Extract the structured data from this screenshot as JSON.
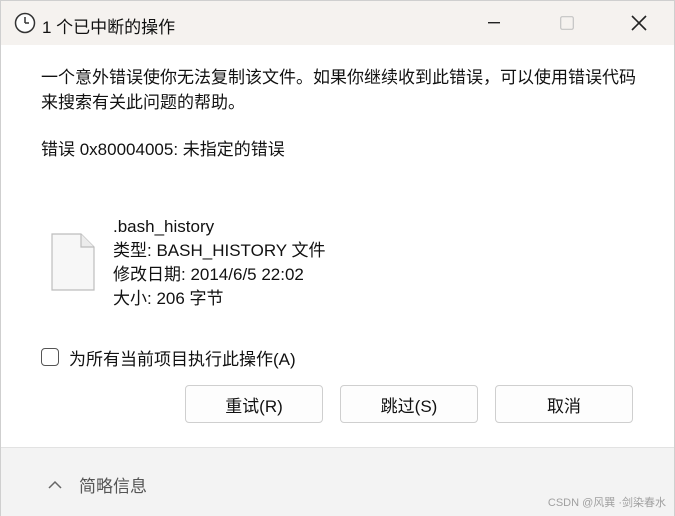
{
  "window": {
    "title": "1 个已中断的操作"
  },
  "dialog": {
    "message": "一个意外错误使你无法复制该文件。如果你继续收到此错误，可以使用错误代码来搜索有关此问题的帮助。",
    "error": "错误 0x80004005: 未指定的错误"
  },
  "file": {
    "name": ".bash_history",
    "type": "类型: BASH_HISTORY 文件",
    "modified": "修改日期: 2014/6/5 22:02",
    "size": "大小: 206 字节"
  },
  "options": {
    "apply_all_label": "为所有当前项目执行此操作(A)",
    "apply_all_checked": false
  },
  "buttons": {
    "retry": "重试(R)",
    "skip": "跳过(S)",
    "cancel": "取消"
  },
  "footer": {
    "toggle_label": "简略信息"
  },
  "watermark": "CSDN @风巽 ·剑染春水"
}
